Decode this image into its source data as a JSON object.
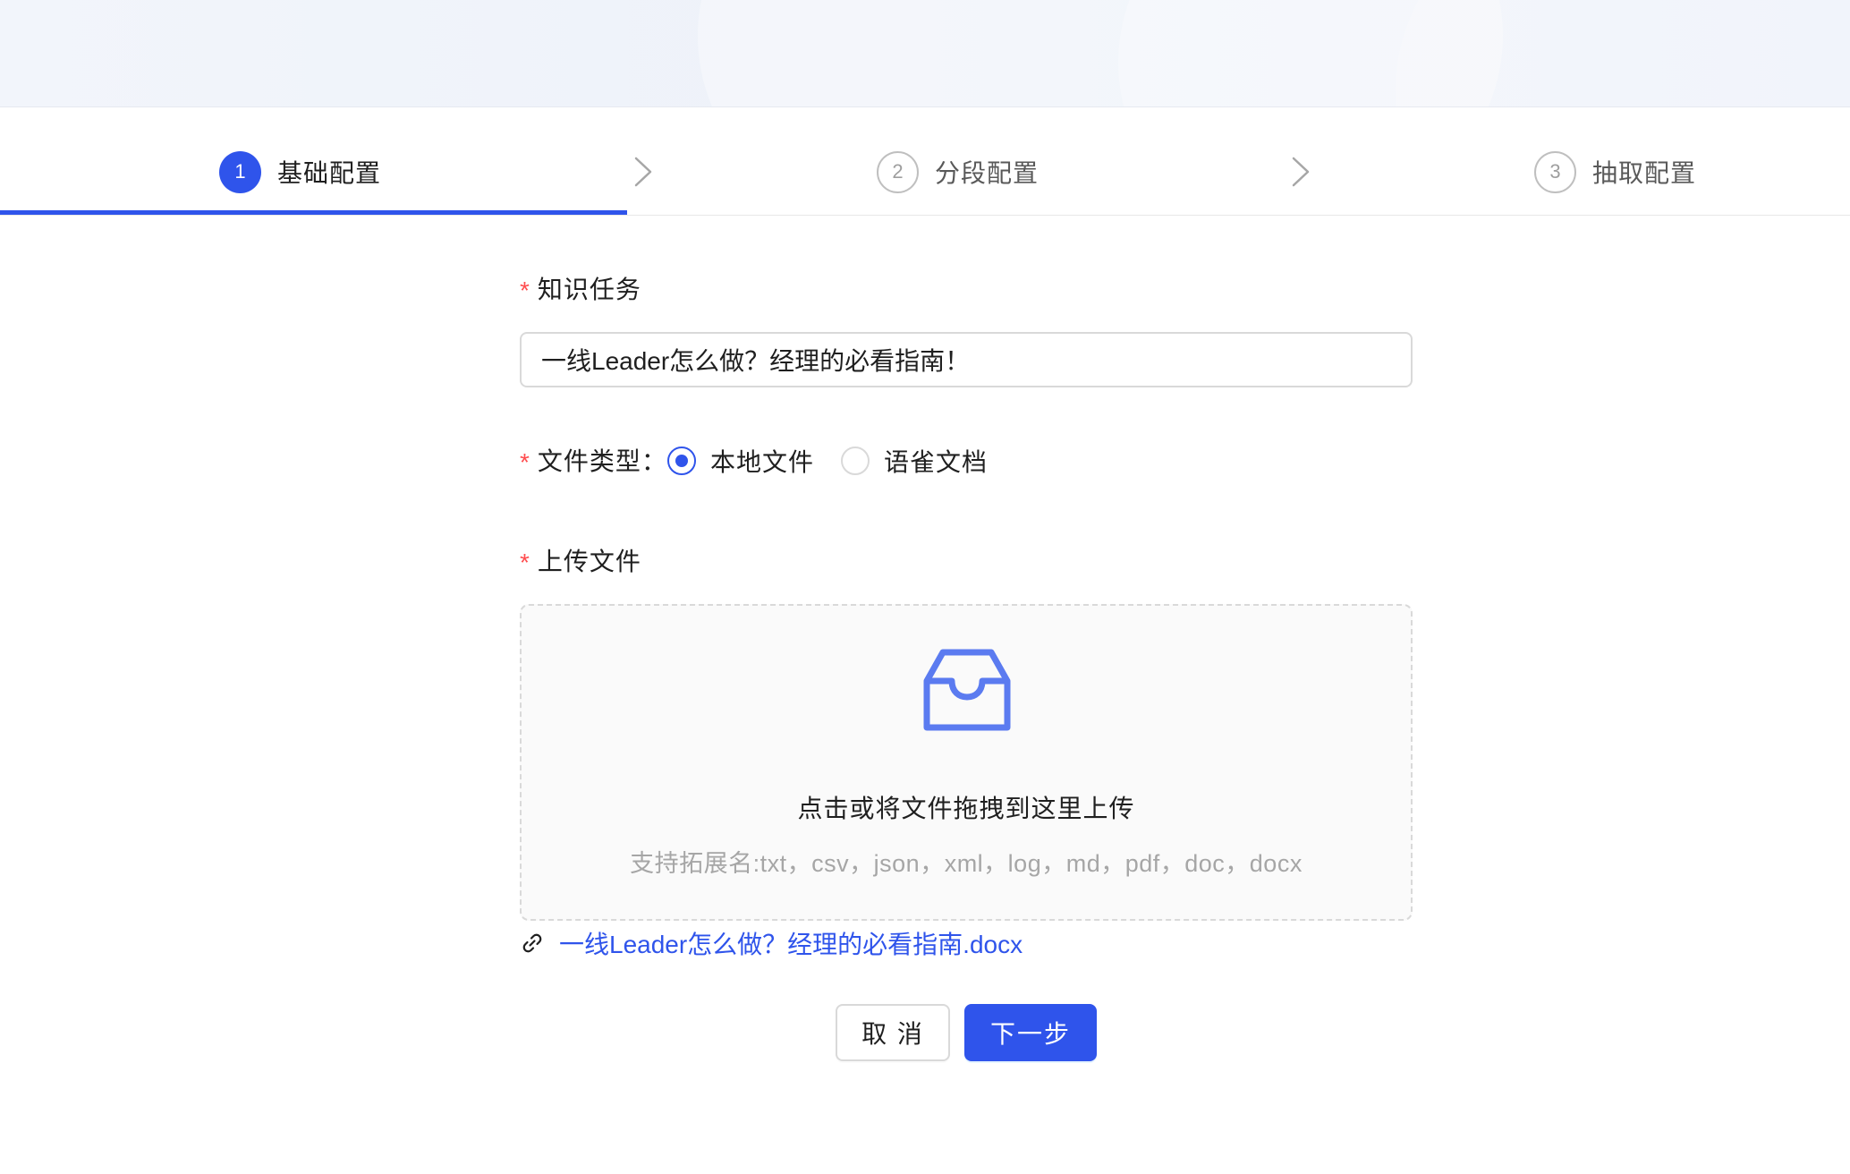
{
  "steps": [
    {
      "number": "1",
      "label": "基础配置",
      "state": "active"
    },
    {
      "number": "2",
      "label": "分段配置",
      "state": "inactive"
    },
    {
      "number": "3",
      "label": "抽取配置",
      "state": "inactive"
    }
  ],
  "form": {
    "task": {
      "required_mark": "*",
      "label": "知识任务",
      "value": "一线Leader怎么做？经理的必看指南！"
    },
    "file_type": {
      "required_mark": "*",
      "label": "文件类型：",
      "options": [
        {
          "label": "本地文件",
          "checked": true
        },
        {
          "label": "语雀文档",
          "checked": false
        }
      ]
    },
    "upload": {
      "required_mark": "*",
      "label": "上传文件",
      "title": "点击或将文件拖拽到这里上传",
      "hint": "支持拓展名:txt，csv，json，xml，log，md，pdf，doc，docx",
      "icon": "inbox-icon",
      "uploaded_file": "一线Leader怎么做？经理的必看指南.docx"
    }
  },
  "buttons": {
    "cancel": "取 消",
    "next": "下一步"
  },
  "colors": {
    "primary": "#2f54eb",
    "required": "#ff4d4f",
    "hint": "#a6a6a6",
    "border": "#d9d9d9"
  }
}
